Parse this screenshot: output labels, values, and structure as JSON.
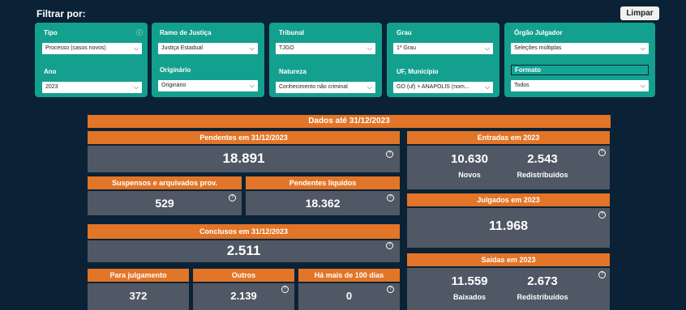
{
  "filter_header": "Filtrar por:",
  "clear_button": "Limpar",
  "filters": {
    "tipo": {
      "label": "Tipo",
      "value": "Processo (casos novos)"
    },
    "ramo": {
      "label": "Ramo de Justiça",
      "value": "Justiça Estadual"
    },
    "tribunal": {
      "label": "Tribunal",
      "value": "TJGO"
    },
    "grau": {
      "label": "Grau",
      "value": "1º Grau"
    },
    "orgao": {
      "label": "Órgão Julgador",
      "value": "Seleções múltiplas"
    },
    "ano": {
      "label": "Ano",
      "value": "2023"
    },
    "originario": {
      "label": "Originário",
      "value": "Originário"
    },
    "natureza": {
      "label": "Natureza",
      "value": "Conhecimento não criminal"
    },
    "uf": {
      "label": "UF, Município",
      "value": "GO (uf) + ANAPOLIS (nom..."
    },
    "formato": {
      "label": "Formato",
      "value": "Todos"
    }
  },
  "dashboard": {
    "dados_ate": "Dados até 31/12/2023",
    "pendentes": {
      "title": "Pendentes em 31/12/2023",
      "value": "18.891"
    },
    "suspensos": {
      "title": "Suspensos e arquivados prov.",
      "value": "529"
    },
    "pendentes_liquidos": {
      "title": "Pendentes líquidos",
      "value": "18.362"
    },
    "conclusos": {
      "title": "Conclusos em 31/12/2023",
      "value": "2.511"
    },
    "para_julgamento": {
      "title": "Para julgamento",
      "value": "372"
    },
    "outros": {
      "title": "Outros",
      "value": "2.139"
    },
    "mais_100": {
      "title": "Há mais de 100 dias",
      "value": "0"
    },
    "entradas": {
      "title": "Entradas em 2023",
      "novos_value": "10.630",
      "novos_label": "Novos",
      "redis_value": "2.543",
      "redis_label": "Redistribuídos"
    },
    "julgados": {
      "title": "Julgados em 2023",
      "value": "11.968"
    },
    "saidas": {
      "title": "Saídas em 2023",
      "baixados_value": "11.559",
      "baixados_label": "Baixados",
      "redis_value": "2.673",
      "redis_label": "Redistribuídos"
    }
  },
  "colors": {
    "background": "#0b2236",
    "filter_card": "#14a08f",
    "header_orange": "#e27527",
    "kpi_gray": "#4f5864"
  }
}
